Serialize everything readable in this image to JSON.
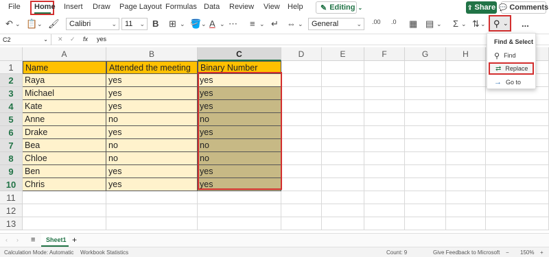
{
  "menu": {
    "file": "File",
    "home": "Home",
    "insert": "Insert",
    "draw": "Draw",
    "page_layout": "Page Layout",
    "formulas": "Formulas",
    "data": "Data",
    "review": "Review",
    "view": "View",
    "help": "Help",
    "editing": "Editing",
    "share": "Share",
    "comments": "Comments"
  },
  "ribbon": {
    "font_name": "Calibri",
    "font_size": "11",
    "bold": "B",
    "font_color_letter": "A",
    "number_format": "General",
    "more": "..."
  },
  "formula_bar": {
    "name_box": "C2",
    "fx": "fx",
    "value": "yes"
  },
  "columns": [
    "A",
    "B",
    "C",
    "D",
    "E",
    "F",
    "G",
    "H",
    "I"
  ],
  "rows": [
    "1",
    "2",
    "3",
    "4",
    "5",
    "6",
    "7",
    "8",
    "9",
    "10",
    "11",
    "12",
    "13"
  ],
  "table": {
    "headers": [
      "Name",
      "Attended the meeting",
      "Binary Number"
    ],
    "rows": [
      [
        "Raya",
        "yes",
        "yes"
      ],
      [
        "Michael",
        "yes",
        "yes"
      ],
      [
        "Kate",
        "yes",
        "yes"
      ],
      [
        "Anne",
        "no",
        "no"
      ],
      [
        "Drake",
        "yes",
        "yes"
      ],
      [
        "Bea",
        "no",
        "no"
      ],
      [
        "Chloe",
        "no",
        "no"
      ],
      [
        "Ben",
        "yes",
        "yes"
      ],
      [
        "Chris",
        "yes",
        "yes"
      ]
    ]
  },
  "find_menu": {
    "title": "Find & Select",
    "find": "Find",
    "replace": "Replace",
    "go_to": "Go to"
  },
  "sheet_tabs": {
    "active": "Sheet1",
    "add": "+"
  },
  "status": {
    "calc_mode": "Calculation Mode: Automatic",
    "workbook_stats": "Workbook Statistics",
    "count": "Count: 9",
    "feedback": "Give Feedback to Microsoft",
    "zoom": "150%"
  },
  "colors": {
    "accent": "#217346",
    "header_fill": "#ffc000",
    "data_fill": "#fff2cc",
    "selected_fill": "#c7b985",
    "highlight_border": "#d32f2f"
  }
}
